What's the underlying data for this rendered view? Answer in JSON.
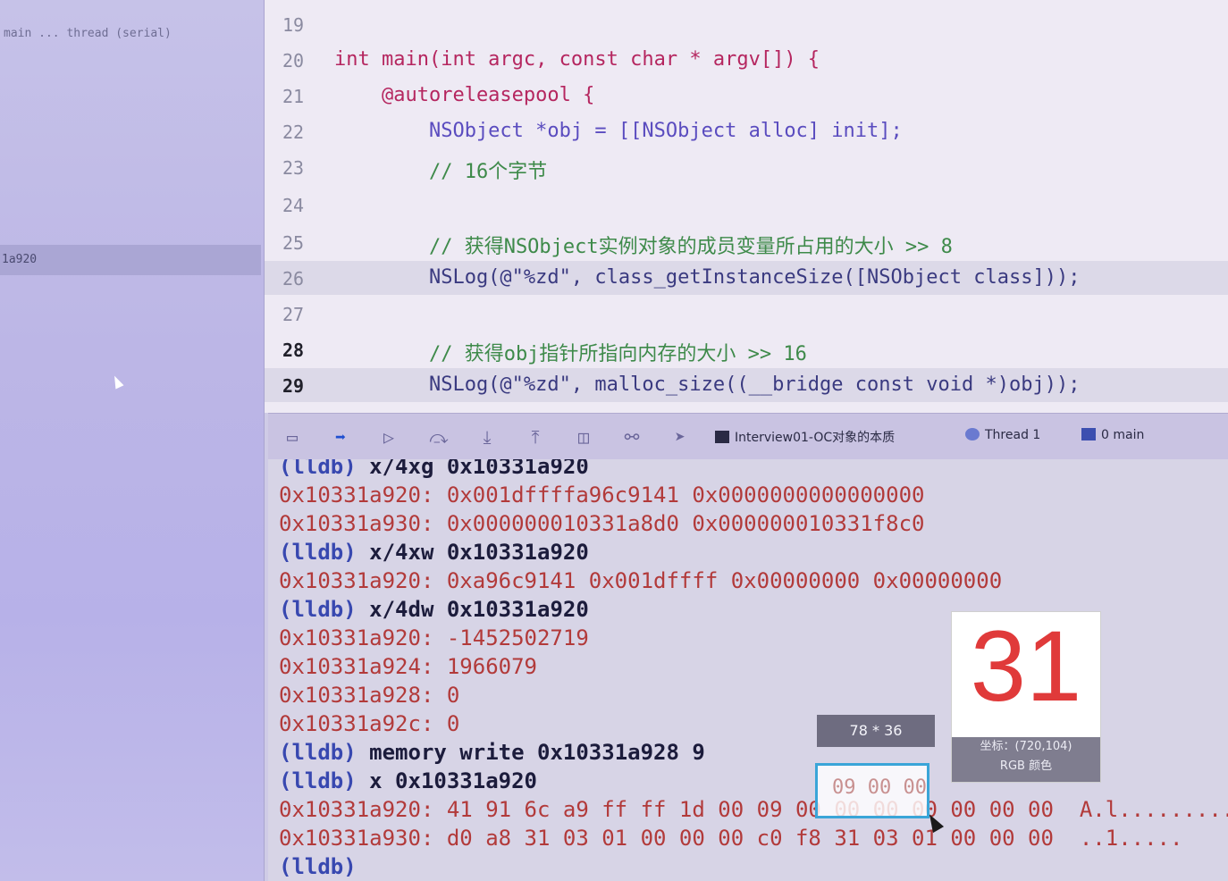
{
  "sidebar": {
    "rows": [
      {
        "label": "main ... thread (serial)"
      },
      {
        "label": "1a920"
      }
    ]
  },
  "editor": {
    "lines": [
      {
        "num": "19",
        "code": ""
      },
      {
        "num": "20",
        "code": "int main(int argc, const char * argv[]) {"
      },
      {
        "num": "21",
        "code": "    @autoreleasepool {"
      },
      {
        "num": "22",
        "code": "        NSObject *obj = [[NSObject alloc] init];"
      },
      {
        "num": "23",
        "code": "        // 16个字节"
      },
      {
        "num": "24",
        "code": ""
      },
      {
        "num": "25",
        "code": "        // 获得NSObject实例对象的成员变量所占用的大小 >> 8"
      },
      {
        "num": "26",
        "code": "        NSLog(@\"%zd\", class_getInstanceSize([NSObject class]));"
      },
      {
        "num": "27",
        "code": ""
      },
      {
        "num": "28",
        "code": "        // 获得obj指针所指向内存的大小 >> 16"
      },
      {
        "num": "29",
        "code": "        NSLog(@\"%zd\", malloc_size((__bridge const void *)obj));"
      }
    ]
  },
  "debug_bar": {
    "project": "Interview01-OC对象的本质",
    "thread": "Thread 1",
    "frame": "0 main"
  },
  "console": {
    "lines": [
      {
        "text": "(lldb) x/4xg 0x10331a920",
        "kind": "cmd"
      },
      {
        "text": "0x10331a920: 0x001dffffa96c9141 0x0000000000000000",
        "kind": "out"
      },
      {
        "text": "0x10331a930: 0x000000010331a8d0 0x000000010331f8c0",
        "kind": "out"
      },
      {
        "text": "(lldb) x/4xw 0x10331a920",
        "kind": "cmd"
      },
      {
        "text": "0x10331a920: 0xa96c9141 0x001dffff 0x00000000 0x00000000",
        "kind": "out"
      },
      {
        "text": "(lldb) x/4dw 0x10331a920",
        "kind": "cmd"
      },
      {
        "text": "0x10331a920: -1452502719",
        "kind": "out"
      },
      {
        "text": "0x10331a924: 1966079",
        "kind": "out"
      },
      {
        "text": "0x10331a928: 0",
        "kind": "out"
      },
      {
        "text": "0x10331a92c: 0",
        "kind": "out"
      },
      {
        "text": "(lldb) memory write 0x10331a928 9",
        "kind": "cmd"
      },
      {
        "text": "(lldb) x 0x10331a920",
        "kind": "cmd"
      },
      {
        "text": "0x10331a920: 41 91 6c a9 ff ff 1d 00 09 00 00 00 00 00 00 00  A.l.........",
        "kind": "out"
      },
      {
        "text": "0x10331a930: d0 a8 31 03 01 00 00 00 c0 f8 31 03 01 00 00 00  ..1.....",
        "kind": "out"
      },
      {
        "text": "(lldb)",
        "kind": "cmd"
      }
    ]
  },
  "overlay": {
    "magnifier_value": "31",
    "magnifier_info_line1": "坐标：(720,104)",
    "magnifier_info_line2": "RGB 颜色",
    "size_tag": "78 * 36",
    "selection_text": "09 00 00"
  },
  "colors": {
    "keyword": "#b5265f",
    "comment": "#3e8a4a",
    "string": "#c8342c",
    "console_output": "#b23a3a",
    "lldb_prompt": "#3848b0",
    "selection_border": "#3aa5d8"
  }
}
